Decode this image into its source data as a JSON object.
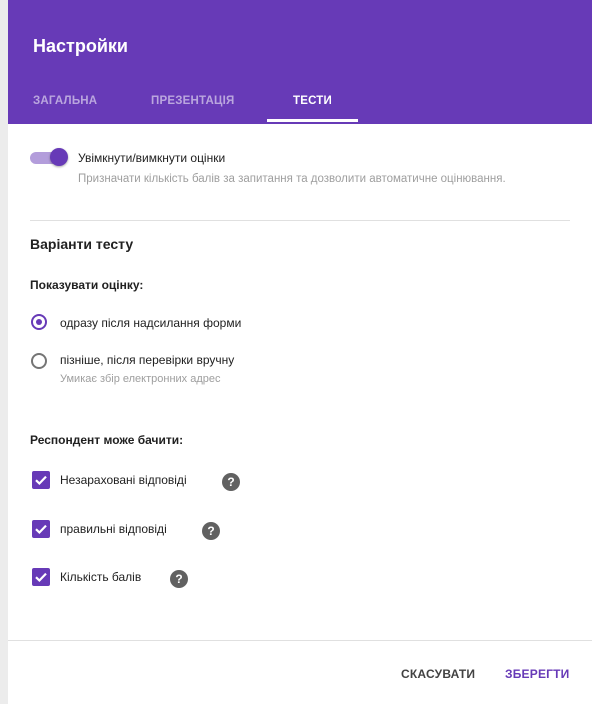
{
  "header": {
    "title": "Настройки",
    "tabs": [
      {
        "label": "ЗАГАЛЬНА",
        "active": false
      },
      {
        "label": "ПРЕЗЕНТАЦІЯ",
        "active": false
      },
      {
        "label": "ТЕСТИ",
        "active": true
      }
    ]
  },
  "quiz_toggle": {
    "label": "Увімкнути/вимкнути оцінки",
    "description": "Призначати кількість балів за запитання та дозволити автоматичне оцінювання.",
    "enabled": true
  },
  "quiz_options": {
    "title": "Варіанти тесту",
    "release_grade": {
      "heading": "Показувати оцінку:",
      "options": [
        {
          "label": "одразу після надсилання форми",
          "selected": true,
          "description": ""
        },
        {
          "label": "пізніше, після перевірки вручну",
          "selected": false,
          "description": "Умикає збір електронних адрес"
        }
      ]
    },
    "respondent_can_see": {
      "heading": "Респондент може бачити:",
      "items": [
        {
          "label": "Незараховані відповіді",
          "checked": true
        },
        {
          "label": "правильні відповіді",
          "checked": true
        },
        {
          "label": "Кількість балів",
          "checked": true
        }
      ]
    }
  },
  "help_glyph": "?",
  "footer": {
    "cancel_label": "СКАСУВАТИ",
    "save_label": "ЗБЕРЕГТИ"
  },
  "colors": {
    "accent": "#673ab7",
    "toggle_track": "#b39ddb",
    "secondary_text": "#9e9e9e"
  }
}
